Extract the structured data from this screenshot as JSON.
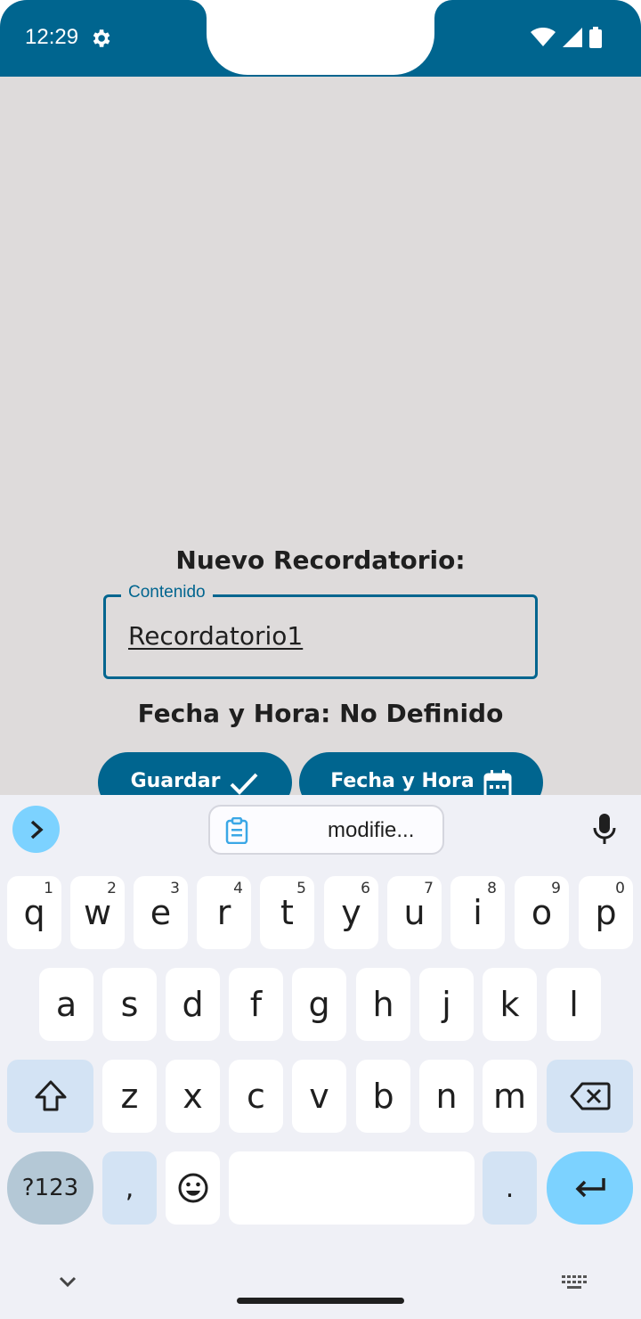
{
  "status_bar": {
    "time": "12:29",
    "settings_icon": "gear-icon",
    "icons": [
      "wifi-icon",
      "signal-icon",
      "battery-icon"
    ]
  },
  "form": {
    "title": "Nuevo Recordatorio:",
    "content_field": {
      "label": "Contenido",
      "value": "Recordatorio1"
    },
    "datetime_text": "Fecha y Hora: No Definido",
    "save_button": {
      "label": "Guardar",
      "icon": "check-icon"
    },
    "datetime_button": {
      "label": "Fecha y Hora",
      "icon": "calendar-icon"
    }
  },
  "keyboard": {
    "suggestion_chip": {
      "text": "modifie...",
      "icon": "clipboard-icon"
    },
    "row1": [
      {
        "k": "q",
        "n": "1"
      },
      {
        "k": "w",
        "n": "2"
      },
      {
        "k": "e",
        "n": "3"
      },
      {
        "k": "r",
        "n": "4"
      },
      {
        "k": "t",
        "n": "5"
      },
      {
        "k": "y",
        "n": "6"
      },
      {
        "k": "u",
        "n": "7"
      },
      {
        "k": "i",
        "n": "8"
      },
      {
        "k": "o",
        "n": "9"
      },
      {
        "k": "p",
        "n": "0"
      }
    ],
    "row2": [
      "a",
      "s",
      "d",
      "f",
      "g",
      "h",
      "j",
      "k",
      "l"
    ],
    "row3": [
      "z",
      "x",
      "c",
      "v",
      "b",
      "n",
      "m"
    ],
    "symbols_label": "?123",
    "comma": ",",
    "period": ".",
    "colors": {
      "accent": "#00658f",
      "enter": "#7cd2ff",
      "function_key": "#d3e3f4"
    }
  }
}
